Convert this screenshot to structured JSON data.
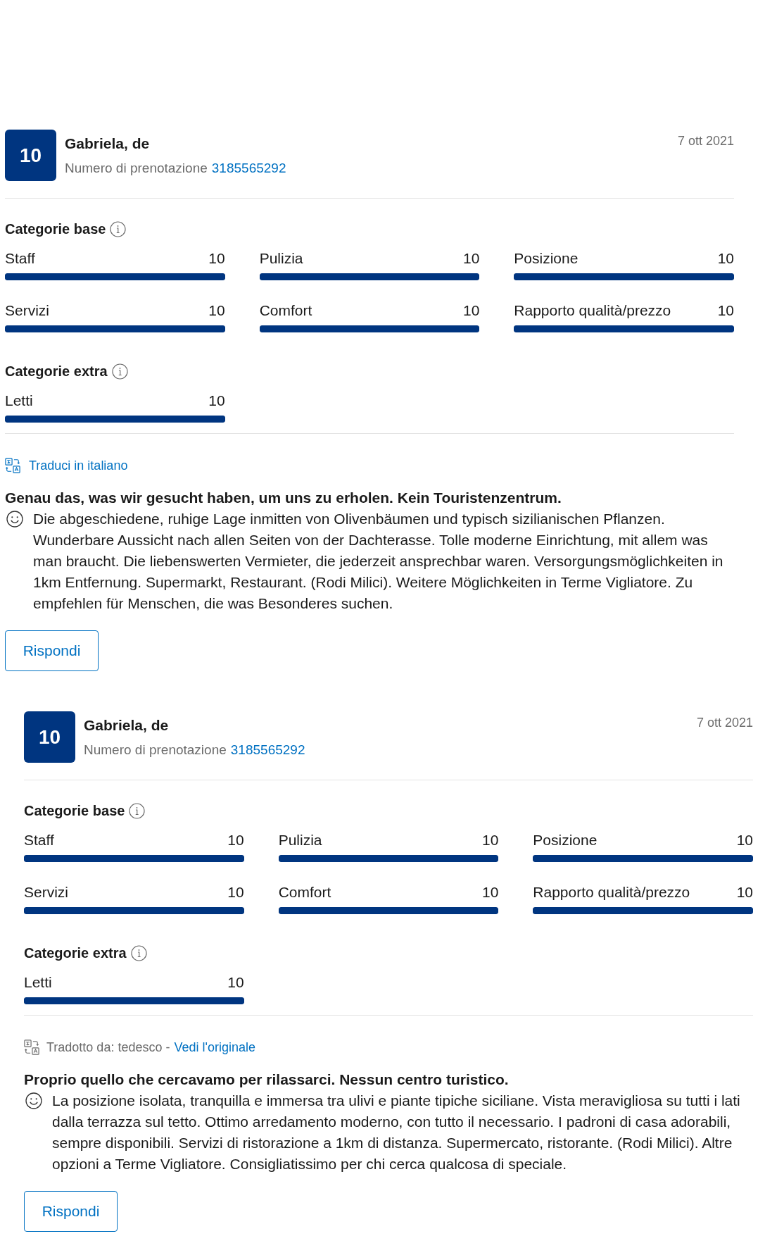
{
  "reviews": [
    {
      "score": "10",
      "reviewer": "Gabriela, de",
      "booking_label": "Numero di prenotazione",
      "booking_number": "3185565292",
      "date": "7 ott 2021",
      "category_groups": [
        {
          "title": "Categorie base",
          "items": [
            {
              "name": "Staff",
              "score": "10",
              "level": 1
            },
            {
              "name": "Pulizia",
              "score": "10",
              "level": 1
            },
            {
              "name": "Posizione",
              "score": "10",
              "level": 1
            },
            {
              "name": "Servizi",
              "score": "10",
              "level": 1
            },
            {
              "name": "Comfort",
              "score": "10",
              "level": 1
            },
            {
              "name": "Rapporto qualità/prezzo",
              "score": "10",
              "level": 1
            }
          ]
        },
        {
          "title": "Categorie extra",
          "items": [
            {
              "name": "Letti",
              "score": "10",
              "level": 1
            }
          ]
        }
      ],
      "translation": {
        "kind": "offer",
        "link": "Traduci in italiano"
      },
      "title": "Genau das, was wir gesucht haben, um uns zu erholen. Kein Touristenzentrum.",
      "body": "Die abgeschiedene, ruhige Lage inmitten von Olivenbäumen und typisch sizilianischen Pflanzen. Wunderbare Aussicht nach allen Seiten von der Dachterasse. Tolle moderne Einrichtung, mit allem was man braucht. Die liebenswerten Vermieter, die jederzeit ansprechbar waren. Versorgungsmöglichkeiten in 1km Entfernung. Supermarkt, Restaurant. (Rodi Milici). Weitere Möglichkeiten in Terme Vigliatore. Zu empfehlen für Menschen, die was Besonderes suchen.",
      "reply_button": "Rispondi"
    },
    {
      "score": "10",
      "reviewer": "Gabriela, de",
      "booking_label": "Numero di prenotazione",
      "booking_number": "3185565292",
      "date": "7 ott 2021",
      "category_groups": [
        {
          "title": "Categorie base",
          "items": [
            {
              "name": "Staff",
              "score": "10",
              "level": 1
            },
            {
              "name": "Pulizia",
              "score": "10",
              "level": 1
            },
            {
              "name": "Posizione",
              "score": "10",
              "level": 1
            },
            {
              "name": "Servizi",
              "score": "10",
              "level": 1
            },
            {
              "name": "Comfort",
              "score": "10",
              "level": 1
            },
            {
              "name": "Rapporto qualità/prezzo",
              "score": "10",
              "level": 1
            }
          ]
        },
        {
          "title": "Categorie extra",
          "items": [
            {
              "name": "Letti",
              "score": "10",
              "level": 1
            }
          ]
        }
      ],
      "translation": {
        "kind": "translated",
        "note": "Tradotto da: tedesco -",
        "link": "Vedi l'originale"
      },
      "title": "Proprio quello che cercavamo per rilassarci. Nessun centro turistico.",
      "body": "La posizione isolata, tranquilla e immersa tra ulivi e piante tipiche siciliane. Vista meravigliosa su tutti i lati dalla terrazza sul tetto. Ottimo arredamento moderno, con tutto il necessario. I padroni di casa adorabili, sempre disponibili. Servizi di ristorazione a 1km di distanza. Supermercato, ristorante. (Rodi Milici). Altre opzioni a Terme Vigliatore. Consigliatissimo per chi cerca qualcosa di speciale.",
      "reply_button": "Rispondi"
    }
  ]
}
